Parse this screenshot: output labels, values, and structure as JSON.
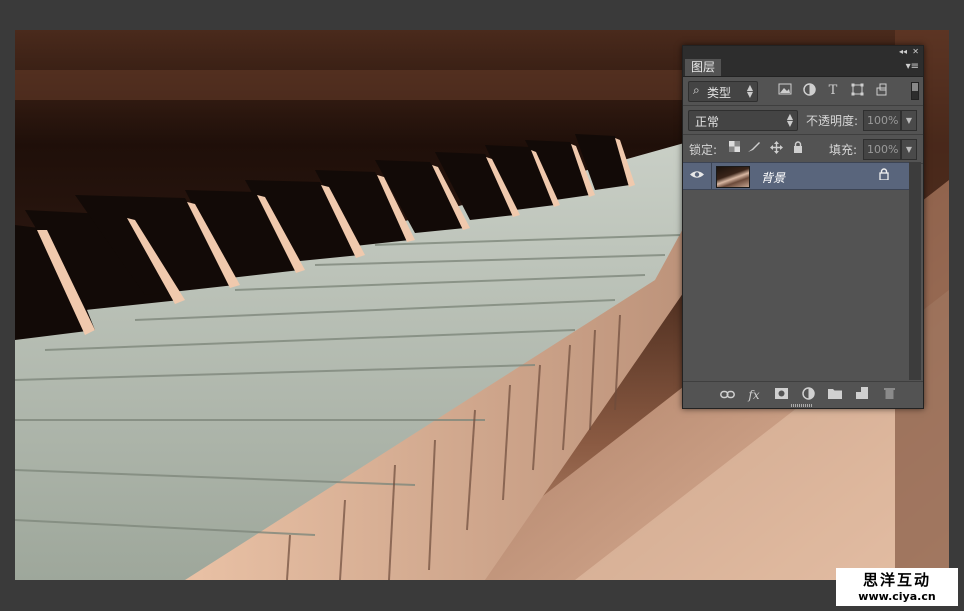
{
  "panel": {
    "collapse_glyph": "◂◂",
    "close_glyph": "✕",
    "menu_glyph": "▾≡",
    "tab_label": "图层",
    "filter": {
      "search_glyph": "⌕",
      "kind_label": "类型"
    },
    "filter_icons": [
      "image-filter-icon",
      "adjustment-filter-icon",
      "type-filter-icon",
      "shape-filter-icon",
      "smart-object-filter-icon"
    ],
    "blend_mode": "正常",
    "opacity_label": "不透明度:",
    "opacity_value": "100%",
    "lock_label": "锁定:",
    "fill_label": "填充:",
    "fill_value": "100%",
    "layers": [
      {
        "name": "背景",
        "visible": true,
        "locked": true,
        "selected": true
      }
    ],
    "bottom_icons": [
      "link-layers-icon",
      "fx-icon",
      "add-mask-icon",
      "new-adjustment-icon",
      "new-group-icon",
      "new-layer-icon",
      "delete-layer-icon"
    ]
  },
  "watermark": {
    "title": "思洋互动",
    "url": "www.ciya.cn"
  },
  "colors": {
    "background": "#3a3a3a",
    "panel": "#535353",
    "selected_layer": "#59657c"
  }
}
